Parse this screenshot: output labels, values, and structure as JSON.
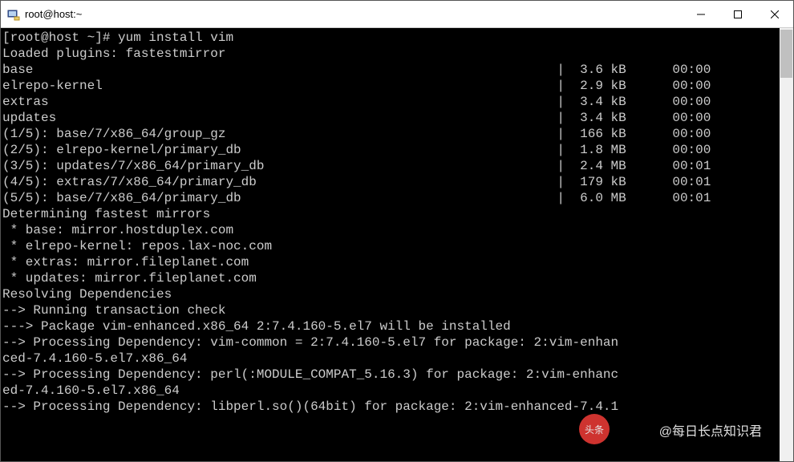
{
  "titlebar": {
    "title": "root@host:~"
  },
  "terminal": {
    "prompt": "[root@host ~]# ",
    "command": "yum install vim",
    "line_loaded": "Loaded plugins: fastestmirror",
    "repos": [
      {
        "name": "base",
        "sep": "| ",
        "size": "3.6 kB",
        "time": "00:00"
      },
      {
        "name": "elrepo-kernel",
        "sep": "| ",
        "size": "2.9 kB",
        "time": "00:00"
      },
      {
        "name": "extras",
        "sep": "| ",
        "size": "3.4 kB",
        "time": "00:00"
      },
      {
        "name": "updates",
        "sep": "| ",
        "size": "3.4 kB",
        "time": "00:00"
      }
    ],
    "downloads": [
      {
        "idx": "(1/5): ",
        "name": "base/7/x86_64/group_gz",
        "sep": "| ",
        "size": "166 kB",
        "time": "00:00"
      },
      {
        "idx": "(2/5): ",
        "name": "elrepo-kernel/primary_db",
        "sep": "| ",
        "size": "1.8 MB",
        "time": "00:00"
      },
      {
        "idx": "(3/5): ",
        "name": "updates/7/x86_64/primary_db",
        "sep": "| ",
        "size": "2.4 MB",
        "time": "00:01"
      },
      {
        "idx": "(4/5): ",
        "name": "extras/7/x86_64/primary_db",
        "sep": "| ",
        "size": "179 kB",
        "time": "00:01"
      },
      {
        "idx": "(5/5): ",
        "name": "base/7/x86_64/primary_db",
        "sep": "| ",
        "size": "6.0 MB",
        "time": "00:01"
      }
    ],
    "determine": "Determining fastest mirrors",
    "mirrors": [
      " * base: mirror.hostduplex.com",
      " * elrepo-kernel: repos.lax-noc.com",
      " * extras: mirror.fileplanet.com",
      " * updates: mirror.fileplanet.com"
    ],
    "resolving": "Resolving Dependencies",
    "trans_check": "--> Running transaction check",
    "pkg_line": "---> Package vim-enhanced.x86_64 2:7.4.160-5.el7 will be installed",
    "dep1a": "--> Processing Dependency: vim-common = 2:7.4.160-5.el7 for package: 2:vim-enhan",
    "dep1b": "ced-7.4.160-5.el7.x86_64",
    "dep2a": "--> Processing Dependency: perl(:MODULE_COMPAT_5.16.3) for package: 2:vim-enhanc",
    "dep2b": "ed-7.4.160-5.el7.x86_64",
    "dep3": "--> Processing Dependency: libperl.so()(64bit) for package: 2:vim-enhanced-7.4.1"
  },
  "watermark": {
    "logo_text": "头条",
    "text": "@每日长点知识君"
  }
}
